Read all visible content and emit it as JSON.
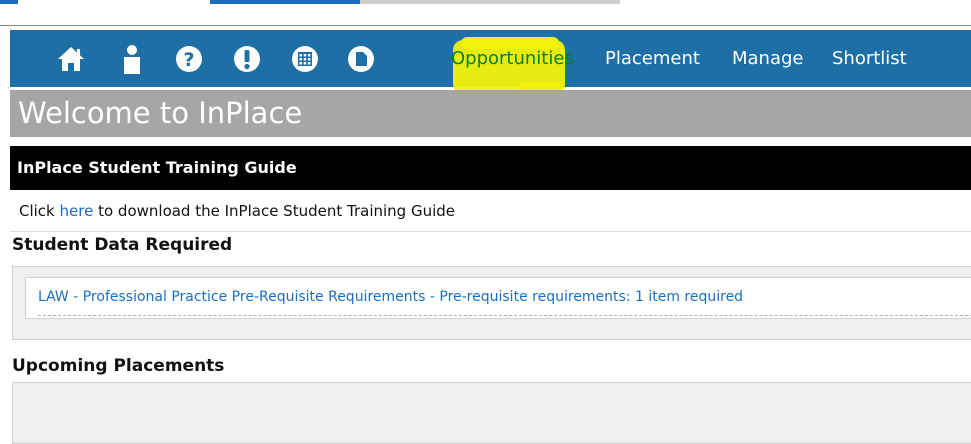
{
  "nav": {
    "icons": [
      "home-icon",
      "person-icon",
      "help-icon",
      "alert-icon",
      "calendar-icon",
      "document-icon"
    ],
    "links": [
      "Opportunities",
      "Placement",
      "Manage",
      "Shortlist"
    ],
    "active": "Opportunities"
  },
  "welcome": {
    "title": "Welcome to InPlace"
  },
  "guide": {
    "header": "InPlace Student Training Guide",
    "prefix": "Click ",
    "link": "here",
    "suffix": " to download the InPlace Student Training Guide"
  },
  "student_data": {
    "title": "Student Data Required",
    "item": "LAW - Professional Practice Pre-Requisite Requirements - Pre-requisite requirements: 1 item required"
  },
  "upcoming": {
    "title": "Upcoming Placements"
  },
  "colors": {
    "nav_bg": "#1e6fa5",
    "welcome_bg": "#a6a6a6",
    "link": "#1a6fc4",
    "highlight": "#f1f10c",
    "active_link": "#0a7f24"
  }
}
